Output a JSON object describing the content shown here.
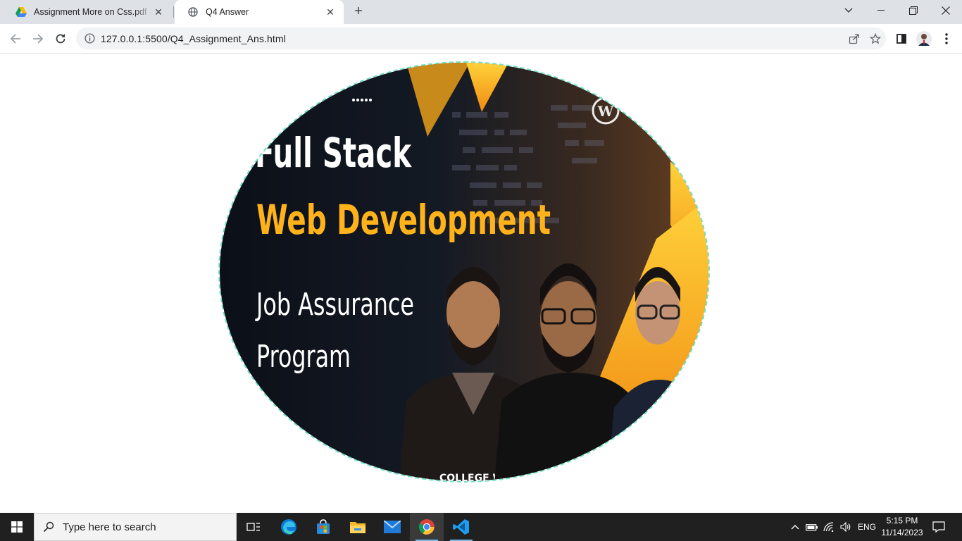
{
  "browser": {
    "tabs": [
      {
        "title": "Assignment More on Css.pdf - G",
        "favicon": "google-drive-icon",
        "active": false
      },
      {
        "title": "Q4 Answer",
        "favicon": "globe-icon",
        "active": true
      }
    ],
    "address": {
      "url": "127.0.0.1:5500/Q4_Assignment_Ans.html"
    }
  },
  "page": {
    "hero_image": {
      "headline_1": "Full Stack",
      "headline_2": "Web Development",
      "headline_3": "Job Assurance",
      "headline_4": "Program",
      "shirt_text": "COLLEGE W",
      "border_color": "#6fe3c4",
      "accent_color": "#f5a623"
    }
  },
  "taskbar": {
    "search_placeholder": "Type here to search",
    "language": "ENG",
    "time": "5:15 PM",
    "date": "11/14/2023"
  }
}
